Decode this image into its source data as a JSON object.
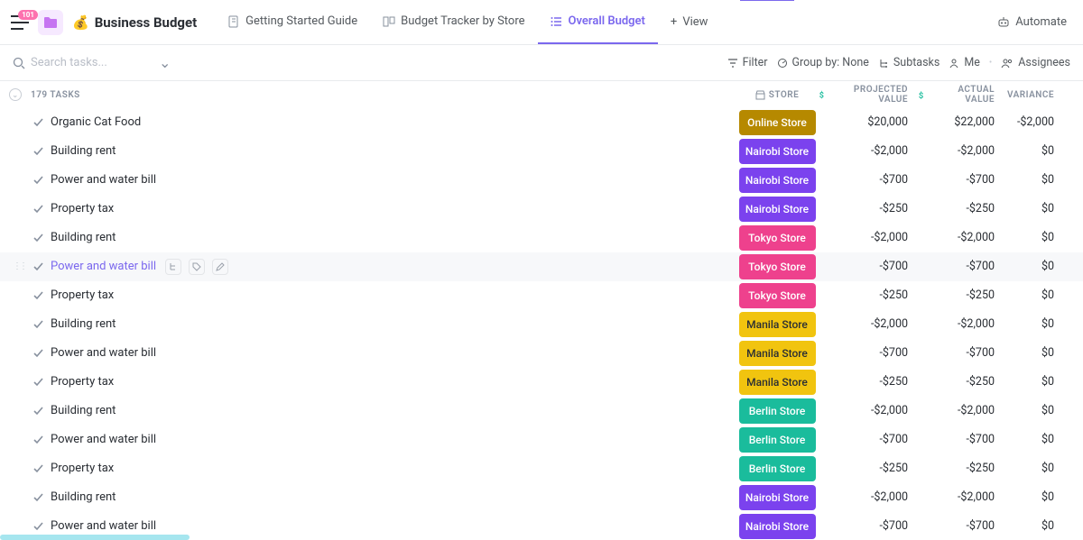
{
  "badge": "101",
  "title": "Business Budget",
  "tabs": [
    {
      "label": "Getting Started Guide"
    },
    {
      "label": "Budget Tracker by Store"
    },
    {
      "label": "Overall Budget"
    }
  ],
  "view_label": "View",
  "automate_label": "Automate",
  "search_placeholder": "Search tasks...",
  "toolbar": {
    "filter": "Filter",
    "group": "Group by: None",
    "subtasks": "Subtasks",
    "me": "Me",
    "assignees": "Assignees"
  },
  "task_count": "179 TASKS",
  "columns": {
    "store": "STORE",
    "projected": "PROJECTED VALUE",
    "actual": "ACTUAL VALUE",
    "variance": "VARIANCE"
  },
  "rows": [
    {
      "name": "Organic Cat Food",
      "store": "Online Store",
      "store_class": "c-online",
      "proj": "$20,000",
      "actual": "$22,000",
      "var": "-$2,000"
    },
    {
      "name": "Building rent",
      "store": "Nairobi Store",
      "store_class": "c-nairobi",
      "proj": "-$2,000",
      "actual": "-$2,000",
      "var": "$0"
    },
    {
      "name": "Power and water bill",
      "store": "Nairobi Store",
      "store_class": "c-nairobi",
      "proj": "-$700",
      "actual": "-$700",
      "var": "$0"
    },
    {
      "name": "Property tax",
      "store": "Nairobi Store",
      "store_class": "c-nairobi",
      "proj": "-$250",
      "actual": "-$250",
      "var": "$0"
    },
    {
      "name": "Building rent",
      "store": "Tokyo Store",
      "store_class": "c-tokyo",
      "proj": "-$2,000",
      "actual": "-$2,000",
      "var": "$0"
    },
    {
      "name": "Power and water bill",
      "store": "Tokyo Store",
      "store_class": "c-tokyo",
      "proj": "-$700",
      "actual": "-$700",
      "var": "$0",
      "hover": true
    },
    {
      "name": "Property tax",
      "store": "Tokyo Store",
      "store_class": "c-tokyo",
      "proj": "-$250",
      "actual": "-$250",
      "var": "$0"
    },
    {
      "name": "Building rent",
      "store": "Manila Store",
      "store_class": "c-manila",
      "proj": "-$2,000",
      "actual": "-$2,000",
      "var": "$0"
    },
    {
      "name": "Power and water bill",
      "store": "Manila Store",
      "store_class": "c-manila",
      "proj": "-$700",
      "actual": "-$700",
      "var": "$0"
    },
    {
      "name": "Property tax",
      "store": "Manila Store",
      "store_class": "c-manila",
      "proj": "-$250",
      "actual": "-$250",
      "var": "$0"
    },
    {
      "name": "Building rent",
      "store": "Berlin Store",
      "store_class": "c-berlin",
      "proj": "-$2,000",
      "actual": "-$2,000",
      "var": "$0"
    },
    {
      "name": "Power and water bill",
      "store": "Berlin Store",
      "store_class": "c-berlin",
      "proj": "-$700",
      "actual": "-$700",
      "var": "$0"
    },
    {
      "name": "Property tax",
      "store": "Berlin Store",
      "store_class": "c-berlin",
      "proj": "-$250",
      "actual": "-$250",
      "var": "$0"
    },
    {
      "name": "Building rent",
      "store": "Nairobi Store",
      "store_class": "c-nairobi",
      "proj": "-$2,000",
      "actual": "-$2,000",
      "var": "$0"
    },
    {
      "name": "Power and water bill",
      "store": "Nairobi Store",
      "store_class": "c-nairobi",
      "proj": "-$700",
      "actual": "-$700",
      "var": "$0"
    }
  ]
}
